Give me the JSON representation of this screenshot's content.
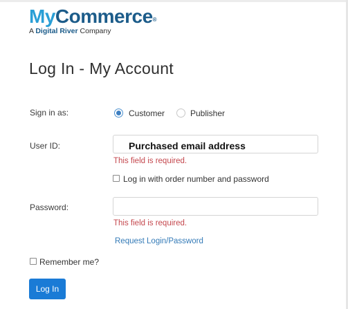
{
  "brand": {
    "name_part1": "My",
    "name_part2": "Commerce",
    "registered_mark": "®",
    "tagline_prefix": "A ",
    "tagline_brand": "Digital River",
    "tagline_suffix": " Company",
    "colors": {
      "light_blue": "#2a9fd6",
      "dark_blue": "#1c5c8a"
    }
  },
  "page": {
    "title": "Log In - My Account"
  },
  "sign_in_as": {
    "label": "Sign in as:",
    "options": [
      {
        "label": "Customer",
        "selected": true
      },
      {
        "label": "Publisher",
        "selected": false
      }
    ]
  },
  "user_id": {
    "label": "User ID:",
    "value": "Purchased email address",
    "error": "This field is required."
  },
  "order_login": {
    "label": "Log in with order number and password",
    "checked": false
  },
  "password": {
    "label": "Password:",
    "value": "",
    "error": "This field is required."
  },
  "request_link": {
    "label": "Request Login/Password"
  },
  "remember": {
    "label": "Remember me?",
    "checked": false
  },
  "login_button": {
    "label": "Log In"
  },
  "colors": {
    "accent": "#1a7bd6",
    "link": "#337ab7",
    "error": "#c4474d",
    "radio_selected": "#3d7fc1"
  }
}
